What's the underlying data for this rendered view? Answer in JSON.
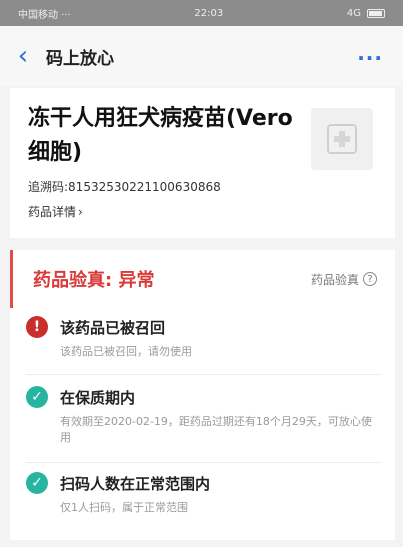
{
  "status_bar": {
    "carrier": "中国移动 ···",
    "time": "22:03",
    "signal": "4G"
  },
  "nav": {
    "back_icon": "‹",
    "title": "码上放心",
    "more_icon": "···"
  },
  "product": {
    "name": "冻干人用狂犬病疫苗(Vero细胞)",
    "trace_label": "追溯码:",
    "trace_code": "81532530221100630868",
    "details_label": "药品详情",
    "details_chevron": "›"
  },
  "verification": {
    "title": "药品验真: 异常",
    "help_label": "药品验真",
    "help_icon": "?",
    "items": [
      {
        "status": "alert",
        "icon": "!",
        "title": "该药品已被召回",
        "description": "该药品已被召回，请勿使用"
      },
      {
        "status": "ok",
        "icon": "✓",
        "title": "在保质期内",
        "description": "有效期至2020-02-19，距药品过期还有18个月29天，可放心使用"
      },
      {
        "status": "ok",
        "icon": "✓",
        "title": "扫码人数在正常范围内",
        "description": "仅1人扫码，属于正常范围"
      }
    ]
  },
  "colors": {
    "accent_blue": "#2c6fd6",
    "alert_red": "#d93a3a",
    "ok_teal": "#27b4a0"
  }
}
